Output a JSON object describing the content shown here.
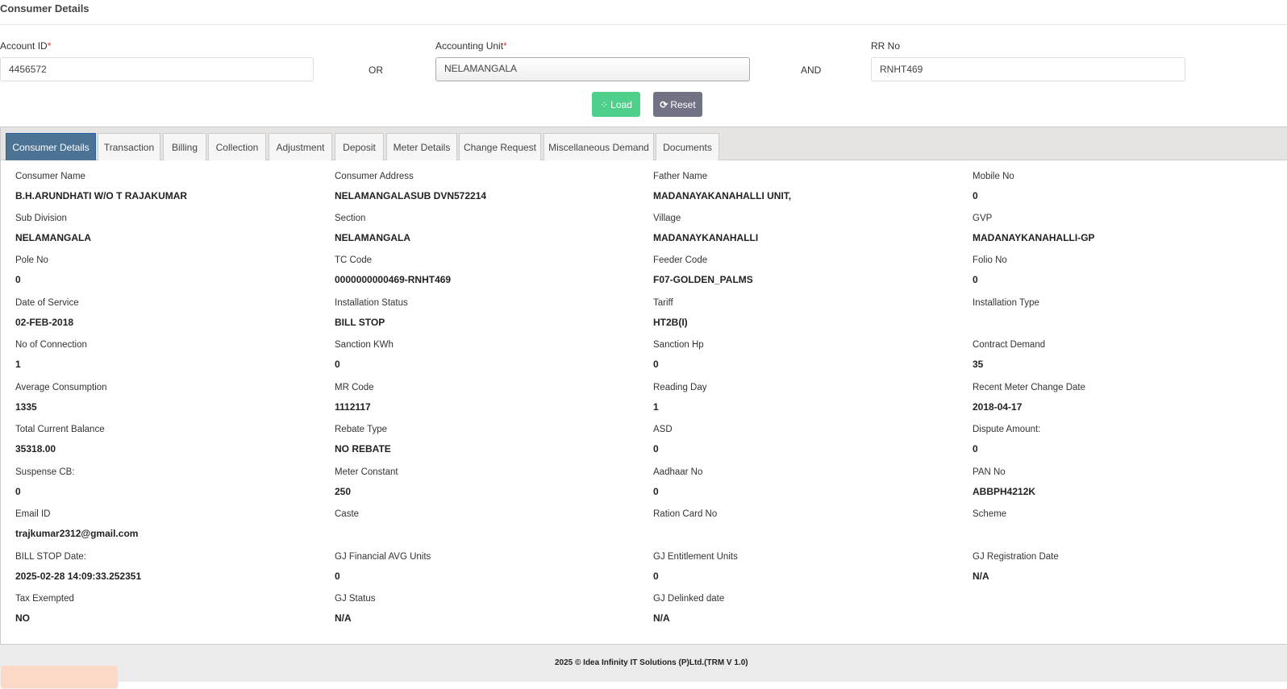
{
  "header": {
    "title": "Consumer Details"
  },
  "form": {
    "account_id_label": "Account ID",
    "account_id_value": "4456572",
    "or": "OR",
    "accounting_unit_label": "Accounting Unit",
    "accounting_unit_value": "NELAMANGALA",
    "and": "AND",
    "rr_label": "RR No",
    "rr_value": "RNHT469",
    "required_mark": "*",
    "load": "Load",
    "reset": "Reset"
  },
  "tabs": [
    "Consumer Details",
    "Transaction",
    "Billing",
    "Collection",
    "Adjustment",
    "Deposit",
    "Meter Details",
    "Change Request",
    "Miscellaneous Demand",
    "Documents"
  ],
  "fields": [
    {
      "label": "Consumer Name",
      "value": "B.H.ARUNDHATI W/O T RAJAKUMAR"
    },
    {
      "label": "Consumer Address",
      "value": "NELAMANGALASUB DVN572214"
    },
    {
      "label": "Father Name",
      "value": "MADANAYAKANAHALLI UNIT,"
    },
    {
      "label": "Mobile No",
      "value": "0"
    },
    {
      "label": "Sub Division",
      "value": "NELAMANGALA"
    },
    {
      "label": "Section",
      "value": "NELAMANGALA"
    },
    {
      "label": "Village",
      "value": "MADANAYKANAHALLI"
    },
    {
      "label": "GVP",
      "value": "MADANAYKANAHALLI-GP"
    },
    {
      "label": "Pole No",
      "value": "0"
    },
    {
      "label": "TC Code",
      "value": "0000000000469-RNHT469"
    },
    {
      "label": "Feeder Code",
      "value": "F07-GOLDEN_PALMS"
    },
    {
      "label": "Folio No",
      "value": "0"
    },
    {
      "label": "Date of Service",
      "value": "02-FEB-2018"
    },
    {
      "label": "Installation Status",
      "value": "BILL STOP"
    },
    {
      "label": "Tariff",
      "value": "HT2B(I)"
    },
    {
      "label": "Installation Type",
      "value": ""
    },
    {
      "label": "No of Connection",
      "value": "1"
    },
    {
      "label": "Sanction KWh",
      "value": "0"
    },
    {
      "label": "Sanction Hp",
      "value": "0"
    },
    {
      "label": "Contract Demand",
      "value": "35"
    },
    {
      "label": "Average Consumption",
      "value": "1335"
    },
    {
      "label": "MR Code",
      "value": "1112117"
    },
    {
      "label": "Reading Day",
      "value": "1"
    },
    {
      "label": "Recent Meter Change Date",
      "value": "2018-04-17"
    },
    {
      "label": "Total Current Balance",
      "value": "35318.00"
    },
    {
      "label": "Rebate Type",
      "value": "NO REBATE"
    },
    {
      "label": "ASD",
      "value": "0"
    },
    {
      "label": "Dispute Amount:",
      "value": "0"
    },
    {
      "label": "Suspense CB:",
      "value": "0"
    },
    {
      "label": "Meter Constant",
      "value": "250"
    },
    {
      "label": "Aadhaar No",
      "value": "0"
    },
    {
      "label": "PAN No",
      "value": "ABBPH4212K"
    },
    {
      "label": "Email ID",
      "value": "trajkumar2312@gmail.com"
    },
    {
      "label": "Caste",
      "value": ""
    },
    {
      "label": "Ration Card No",
      "value": ""
    },
    {
      "label": "Scheme",
      "value": ""
    },
    {
      "label": "BILL STOP Date:",
      "value": "2025-02-28 14:09:33.252351"
    },
    {
      "label": "GJ Financial AVG Units",
      "value": "0"
    },
    {
      "label": "GJ Entitlement Units",
      "value": "0"
    },
    {
      "label": "GJ Registration Date",
      "value": "N/A"
    },
    {
      "label": "Tax Exempted",
      "value": "NO"
    },
    {
      "label": "GJ Status",
      "value": "N/A"
    },
    {
      "label": "GJ Delinked date",
      "value": "N/A"
    }
  ],
  "footer": {
    "text": "2025 © Idea Infinity IT Solutions (P)Ltd.(TRM V 1.0)"
  },
  "colors": {
    "load": "#4fd08a",
    "reset": "#717385",
    "active_tab": "#4c7396"
  }
}
